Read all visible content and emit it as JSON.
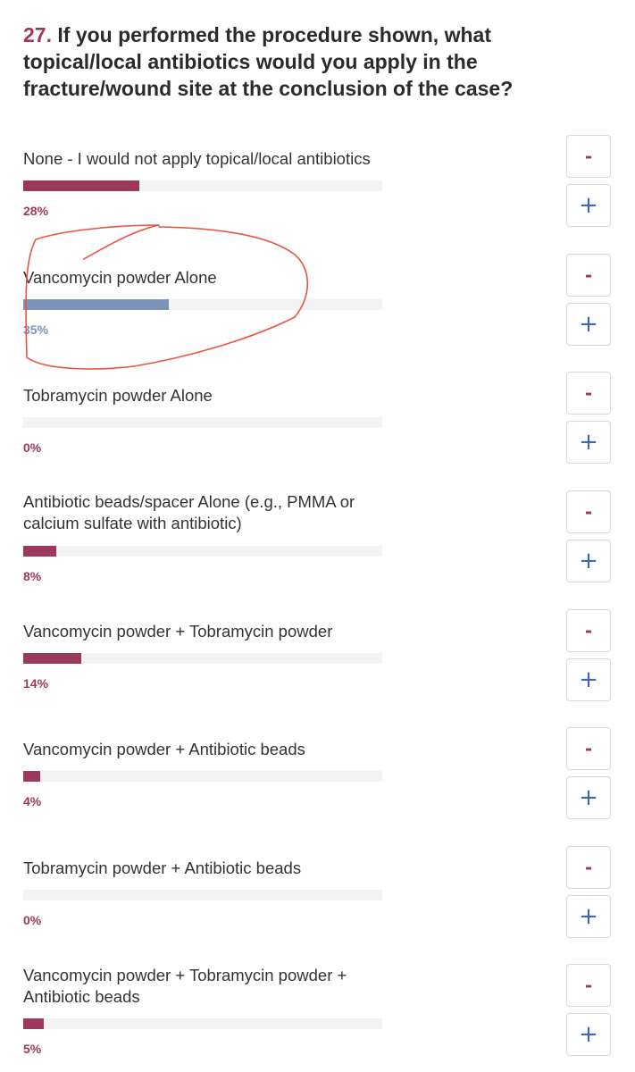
{
  "question": {
    "number": "27.",
    "text": "If you performed the procedure shown, what topical/local antibiotics would you apply in the fracture/wound site at the conclusion of the case?"
  },
  "buttons": {
    "minus_label": "-",
    "plus_label": "+"
  },
  "colors": {
    "bar": "#9b3a5e",
    "bar_selected": "#7c93b9",
    "plus": "#3f66b0",
    "annotation": "#e8553f"
  },
  "options": [
    {
      "label": "None - I would not apply topical/local antibiotics",
      "percent": 28,
      "percent_text": "28%",
      "selected": false
    },
    {
      "label": "Vancomycin powder Alone",
      "percent": 35,
      "percent_text": "35%",
      "selected": true
    },
    {
      "label": "Tobramycin powder Alone",
      "percent": 0,
      "percent_text": "0%",
      "selected": false
    },
    {
      "label": "Antibiotic beads/spacer Alone (e.g., PMMA or calcium sulfate with antibiotic)",
      "percent": 8,
      "percent_text": "8%",
      "selected": false
    },
    {
      "label": "Vancomycin powder + Tobramycin powder",
      "percent": 14,
      "percent_text": "14%",
      "selected": false
    },
    {
      "label": "Vancomycin powder + Antibiotic beads",
      "percent": 4,
      "percent_text": "4%",
      "selected": false
    },
    {
      "label": "Tobramycin powder + Antibiotic beads",
      "percent": 0,
      "percent_text": "0%",
      "selected": false
    },
    {
      "label": "Vancomycin powder + Tobramycin powder + Antibiotic beads",
      "percent": 5,
      "percent_text": "5%",
      "selected": false
    }
  ]
}
